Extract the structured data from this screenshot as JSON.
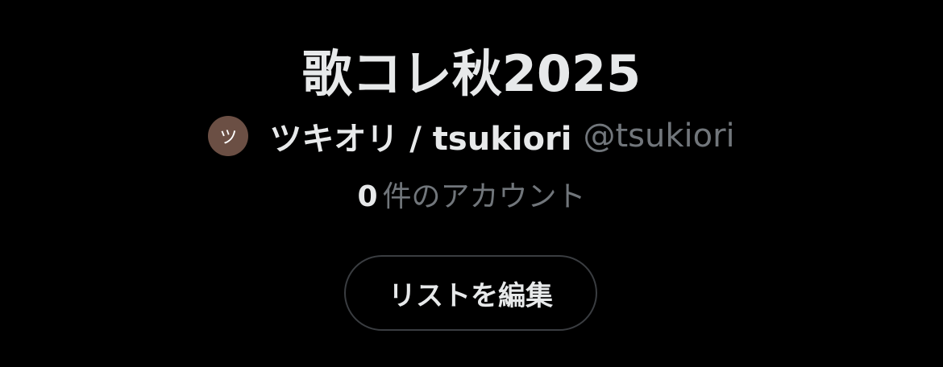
{
  "list": {
    "title": "歌コレ秋2025",
    "owner": {
      "avatar_initial": "ツ",
      "avatar_color": "#6b4f44",
      "display_name": "ツキオリ / tsukiori",
      "handle": "@tsukiori"
    },
    "member_count": {
      "number": "0",
      "label": "件のアカウント"
    },
    "edit_button_label": "リストを編集"
  },
  "colors": {
    "background": "#000000",
    "primary_text": "#e7e9ea",
    "secondary_text": "#71767b",
    "button_border": "#3a3d41"
  }
}
